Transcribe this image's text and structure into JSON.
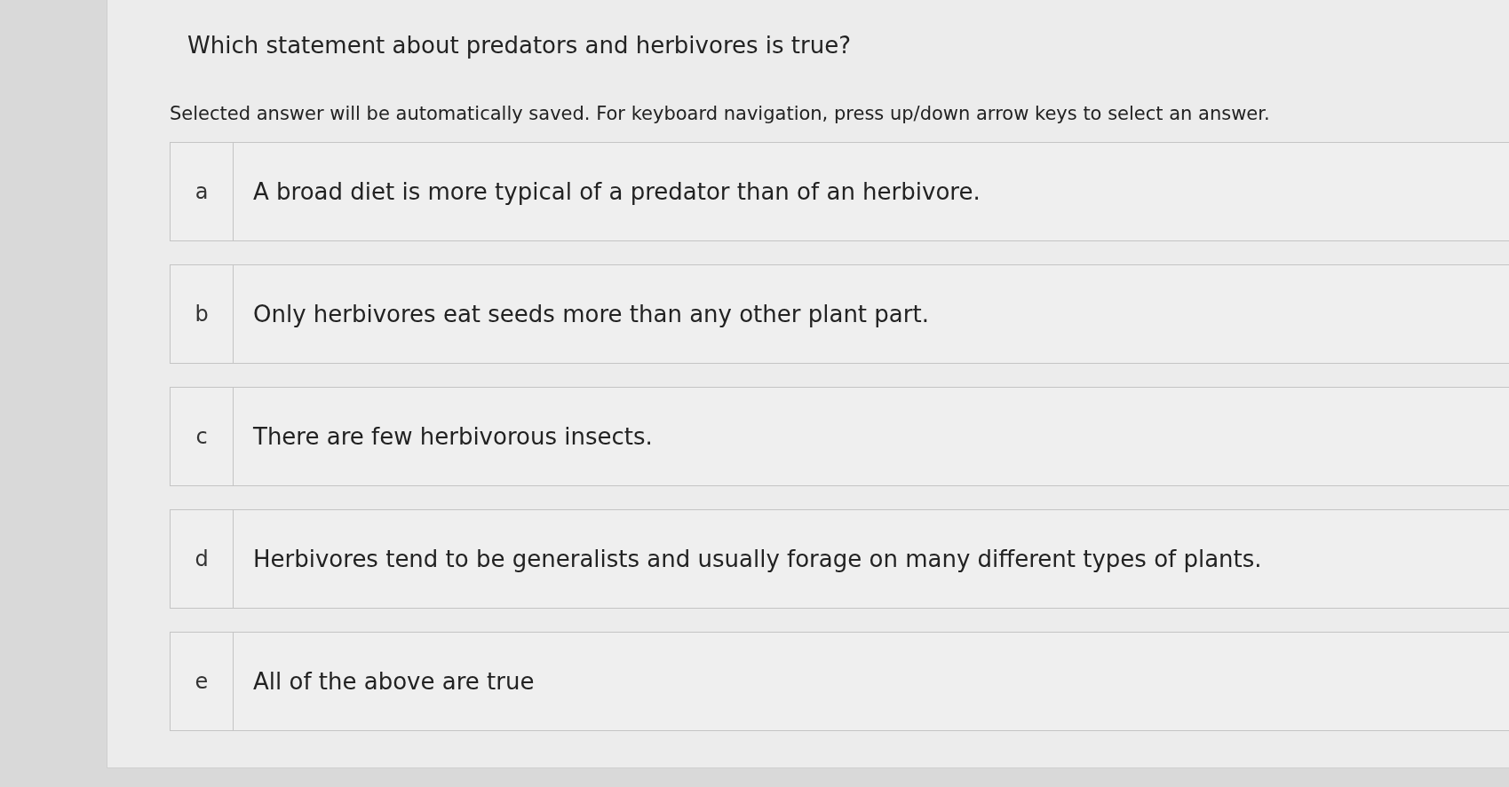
{
  "question": {
    "text": "Which statement about predators and herbivores is true?",
    "instructions": "Selected answer will be automatically saved. For keyboard navigation, press up/down arrow keys to select an answer."
  },
  "options": [
    {
      "letter": "a",
      "text": "A broad diet is more typical of a predator than of an herbivore.",
      "selected": false
    },
    {
      "letter": "b",
      "text": "Only herbivores eat seeds more than any other plant part.",
      "selected": false
    },
    {
      "letter": "c",
      "text": "There are few herbivorous insects.",
      "selected": false
    },
    {
      "letter": "d",
      "text": "Herbivores tend to be generalists and usually forage on many different types of plants.",
      "selected": false
    },
    {
      "letter": "e",
      "text": "All of the above are true",
      "selected": false
    }
  ]
}
